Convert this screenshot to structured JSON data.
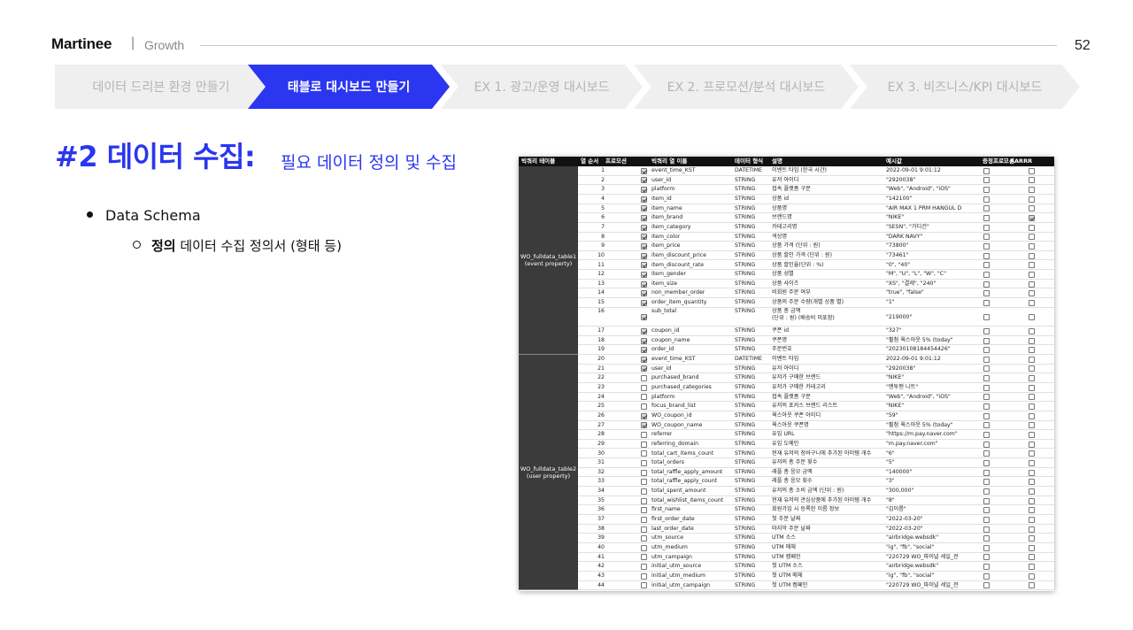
{
  "header": {
    "brand": "Martinee",
    "separator": "|",
    "section": "Growth",
    "page_number": "52"
  },
  "steps": [
    {
      "label": "데이터 드리븐 환경 만들기",
      "active": false
    },
    {
      "label": "태블로 대시보드 만들기",
      "active": true
    },
    {
      "label": "EX 1. 광고/운영 대시보드",
      "active": false
    },
    {
      "label": "EX 2. 프로모션/분석 대시보드",
      "active": false
    },
    {
      "label": "EX 3. 비즈니스/KPI 대시보드",
      "active": false
    }
  ],
  "title": {
    "main": "#2 데이터 수집:",
    "sub": "필요 데이터 정의 및 수집"
  },
  "bullets": {
    "level1": "Data Schema",
    "level2_bold": "정의",
    "level2_rest": " 데이터 수집 정의서 (형태 등)"
  },
  "schema_table": {
    "columns": [
      "빅쿼리 테이블",
      "열 순서",
      "프로모션",
      "빅쿼리 열 이름",
      "데이터 형식",
      "설명",
      "예시값",
      "증정프로모션",
      "AARRR"
    ],
    "groups": [
      {
        "label": "WO_fulldata_table1\n(event property)",
        "start": 1,
        "end": 19
      },
      {
        "label": "WO_fulldata_table2\n(user property)",
        "start": 20,
        "end": 44
      }
    ],
    "rows": [
      {
        "n": "1",
        "p": true,
        "name": "event_time_KST",
        "type": "DATETIME",
        "desc": "이벤트 타임 (한국 시간)",
        "ex": "2022-09-01 9:01:12",
        "g": false,
        "a": false
      },
      {
        "n": "2",
        "p": true,
        "name": "user_id",
        "type": "STRING",
        "desc": "유저 아이디",
        "ex": "\"2920038\"",
        "g": false,
        "a": false
      },
      {
        "n": "3",
        "p": true,
        "name": "platform",
        "type": "STRING",
        "desc": "접속 플랫폼 구분",
        "ex": "\"Web\", \"Android\", \"iOS\"",
        "g": false,
        "a": false
      },
      {
        "n": "4",
        "p": true,
        "name": "item_id",
        "type": "STRING",
        "desc": "상품 id",
        "ex": "\"142100\"",
        "g": false,
        "a": false
      },
      {
        "n": "5",
        "p": true,
        "name": "item_name",
        "type": "STRING",
        "desc": "상품명",
        "ex": "\"AIR MAX 1 PRM HANGUL D",
        "g": false,
        "a": false
      },
      {
        "n": "6",
        "p": true,
        "name": "item_brand",
        "type": "STRING",
        "desc": "브랜드명",
        "ex": "\"NIKE\"",
        "g": false,
        "a": true
      },
      {
        "n": "7",
        "p": true,
        "name": "item_category",
        "type": "STRING",
        "desc": "카테고리명",
        "ex": "\"SESN\", \"가디건\"",
        "g": false,
        "a": false
      },
      {
        "n": "8",
        "p": true,
        "name": "item_color",
        "type": "STRING",
        "desc": "색상명",
        "ex": "\"DARK NAVY\"",
        "g": false,
        "a": false
      },
      {
        "n": "9",
        "p": true,
        "name": "item_price",
        "type": "STRING",
        "desc": "상품 가격 (단위 : 원)",
        "ex": "\"73800\"",
        "g": false,
        "a": false
      },
      {
        "n": "10",
        "p": true,
        "name": "item_discount_price",
        "type": "STRING",
        "desc": "상품 할인 가격 (단위 : 원)",
        "ex": "\"73461\"",
        "g": false,
        "a": false
      },
      {
        "n": "11",
        "p": true,
        "name": "item_discount_rate",
        "type": "STRING",
        "desc": "상품 할인율(단위 : %)",
        "ex": "\"0\", \"40\"",
        "g": false,
        "a": false
      },
      {
        "n": "12",
        "p": true,
        "name": "item_gender",
        "type": "STRING",
        "desc": "상품 성별",
        "ex": "\"M\", \"U\", \"L\", \"W\", \"C\"",
        "g": false,
        "a": false
      },
      {
        "n": "13",
        "p": true,
        "name": "item_size",
        "type": "STRING",
        "desc": "상품 사이즈",
        "ex": "\"XS\", \"결제\", \"240\"",
        "g": false,
        "a": false
      },
      {
        "n": "14",
        "p": true,
        "name": "non_member_order",
        "type": "STRING",
        "desc": "비회원 주문 여부",
        "ex": "\"true\", \"false\"",
        "g": false,
        "a": false
      },
      {
        "n": "15",
        "p": true,
        "name": "order_item_quantity",
        "type": "STRING",
        "desc": "상품의 주문 수량(개별 상품 별)",
        "ex": "\"1\"",
        "g": false,
        "a": false
      },
      {
        "n": "16",
        "p": true,
        "name": "sub_total",
        "type": "STRING",
        "desc": "상품 총 금액\n(단위 : 원) (배송비 미포함)",
        "ex": "\"219000\"",
        "g": false,
        "a": false
      },
      {
        "n": "17",
        "p": true,
        "name": "coupon_id",
        "type": "STRING",
        "desc": "쿠폰 id",
        "ex": "\"327\"",
        "g": false,
        "a": false
      },
      {
        "n": "18",
        "p": true,
        "name": "coupon_name",
        "type": "STRING",
        "desc": "쿠폰명",
        "ex": "\"휠첨 웍스아웃 5% (today\"",
        "g": false,
        "a": false
      },
      {
        "n": "19",
        "p": true,
        "name": "order_id",
        "type": "STRING",
        "desc": "주문번호",
        "ex": "\"20230108184454426\"",
        "g": false,
        "a": false
      },
      {
        "n": "20",
        "p": true,
        "name": "event_time_KST",
        "type": "DATETIME",
        "desc": "이벤트 타임",
        "ex": "2022-09-01 9:01:12",
        "g": false,
        "a": false
      },
      {
        "n": "21",
        "p": true,
        "name": "user_id",
        "type": "STRING",
        "desc": "유저 아이디",
        "ex": "\"2920038\"",
        "g": false,
        "a": false
      },
      {
        "n": "22",
        "p": false,
        "name": "purchased_brand",
        "type": "STRING",
        "desc": "유저가 구매한 브랜드",
        "ex": "\"NIKE\"",
        "g": false,
        "a": false
      },
      {
        "n": "23",
        "p": false,
        "name": "purchased_categories",
        "type": "STRING",
        "desc": "유저가 구매한 카테고리",
        "ex": "\"맨투맨 니트\"",
        "g": false,
        "a": false
      },
      {
        "n": "24",
        "p": false,
        "name": "platform",
        "type": "STRING",
        "desc": "접속 플랫폼 구분",
        "ex": "\"Web\", \"Android\", \"iOS\"",
        "g": false,
        "a": false
      },
      {
        "n": "25",
        "p": false,
        "name": "focus_brand_list",
        "type": "STRING",
        "desc": "유저의 포커스 브랜드 리스트",
        "ex": "\"NIKE\"",
        "g": false,
        "a": false
      },
      {
        "n": "26",
        "p": true,
        "name": "WO_coupon_id",
        "type": "STRING",
        "desc": "웍스아웃 쿠폰 아이디",
        "ex": "\"59\"",
        "g": false,
        "a": false
      },
      {
        "n": "27",
        "p": true,
        "name": "WO_coupon_name",
        "type": "STRING",
        "desc": "웍스아웃 쿠폰명",
        "ex": "\"휠첨 웍스아웃 5% (today\"",
        "g": false,
        "a": false
      },
      {
        "n": "28",
        "p": false,
        "name": "referrer",
        "type": "STRING",
        "desc": "유입 URL",
        "ex": "\"https://m.pay.naver.com\"",
        "g": false,
        "a": false
      },
      {
        "n": "29",
        "p": false,
        "name": "referring_domain",
        "type": "STRING",
        "desc": "유입 도메인",
        "ex": "\"m.pay.naver.com\"",
        "g": false,
        "a": false
      },
      {
        "n": "30",
        "p": false,
        "name": "total_cart_items_count",
        "type": "STRING",
        "desc": "현재 유저의 장바구니에 추가된 아이템 개수",
        "ex": "\"6\"",
        "g": false,
        "a": false
      },
      {
        "n": "31",
        "p": false,
        "name": "total_orders",
        "type": "STRING",
        "desc": "유저의 총 주문 횟수",
        "ex": "\"5\"",
        "g": false,
        "a": false
      },
      {
        "n": "32",
        "p": false,
        "name": "total_raffle_apply_amount",
        "type": "STRING",
        "desc": "래플 총 응모 금액",
        "ex": "\"140000\"",
        "g": false,
        "a": false
      },
      {
        "n": "33",
        "p": false,
        "name": "total_raffle_apply_count",
        "type": "STRING",
        "desc": "래플 총 응모 횟수",
        "ex": "\"3\"",
        "g": false,
        "a": false
      },
      {
        "n": "34",
        "p": false,
        "name": "total_spent_amount",
        "type": "STRING",
        "desc": "유저의 총 소비 금액 (단위 : 원)",
        "ex": "\"300,000\"",
        "g": false,
        "a": false
      },
      {
        "n": "35",
        "p": false,
        "name": "total_wishlist_items_count",
        "type": "STRING",
        "desc": "현재 유저의 관심상품에 추가된 아이템 개수",
        "ex": "\"8\"",
        "g": false,
        "a": false
      },
      {
        "n": "36",
        "p": false,
        "name": "first_name",
        "type": "STRING",
        "desc": "회원가입 시 등록한 이름 정보",
        "ex": "\"김이름\"",
        "g": false,
        "a": false
      },
      {
        "n": "37",
        "p": false,
        "name": "first_order_date",
        "type": "STRING",
        "desc": "첫 주문 날짜",
        "ex": "\"2022-03-20\"",
        "g": false,
        "a": false
      },
      {
        "n": "38",
        "p": false,
        "name": "last_order_date",
        "type": "STRING",
        "desc": "마지막 주문 날짜",
        "ex": "\"2022-03-20\"",
        "g": false,
        "a": false
      },
      {
        "n": "39",
        "p": false,
        "name": "utm_source",
        "type": "STRING",
        "desc": "UTM 소스",
        "ex": "\"airbridge.websdk\"",
        "g": false,
        "a": false
      },
      {
        "n": "40",
        "p": false,
        "name": "utm_medium",
        "type": "STRING",
        "desc": "UTM 매체",
        "ex": "\"ig\", \"fb\", \"social\"",
        "g": false,
        "a": false
      },
      {
        "n": "41",
        "p": false,
        "name": "utm_campaign",
        "type": "STRING",
        "desc": "UTM 캠페인",
        "ex": "\"220729 WO_파이널 세일_전",
        "g": false,
        "a": false
      },
      {
        "n": "42",
        "p": false,
        "name": "initial_utm_source",
        "type": "STRING",
        "desc": "첫 UTM 소스",
        "ex": "\"airbridge.websdk\"",
        "g": false,
        "a": false
      },
      {
        "n": "43",
        "p": false,
        "name": "initial_utm_medium",
        "type": "STRING",
        "desc": "첫 UTM 매체",
        "ex": "\"ig\", \"fb\", \"social\"",
        "g": false,
        "a": false
      },
      {
        "n": "44",
        "p": false,
        "name": "initial_utm_campaign",
        "type": "STRING",
        "desc": "첫 UTM 캠페인",
        "ex": "\"220729 WO_파이널 세일_전",
        "g": false,
        "a": false
      }
    ]
  },
  "colors": {
    "accent": "#2a36f0",
    "step_inactive": "#efefef",
    "group_fill": "#3b3b3b"
  }
}
